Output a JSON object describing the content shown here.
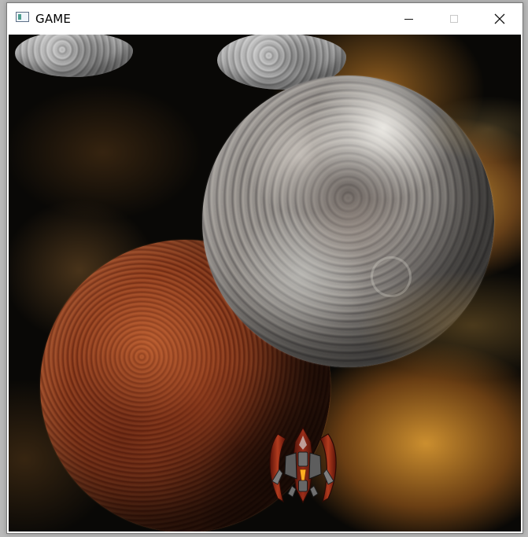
{
  "window": {
    "title": "GAME",
    "icon": "app-window-icon",
    "controls": {
      "minimize_icon": "minimize-icon",
      "maximize_icon": "maximize-icon",
      "close_icon": "close-icon"
    }
  },
  "scene": {
    "background": "nebula-space",
    "objects": [
      {
        "name": "asteroid"
      },
      {
        "name": "asteroid"
      },
      {
        "name": "moon-planet"
      },
      {
        "name": "mars-planet"
      },
      {
        "name": "player-ship"
      }
    ]
  },
  "colors": {
    "space_dark": "#090806",
    "nebula_orange": "#d69c39",
    "mars_red": "#8f3f20",
    "moon_gray": "#8f8b87",
    "ship_red": "#8b2a18"
  }
}
